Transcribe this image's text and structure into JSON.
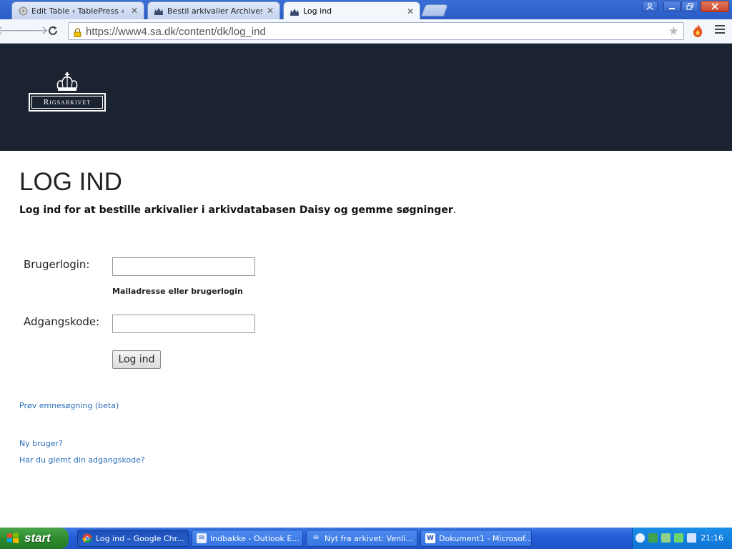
{
  "browser": {
    "tabs": [
      {
        "label": "Edit Table ‹ TablePress ‹ — W",
        "icon": "wordpress-icon",
        "active": false
      },
      {
        "label": "Bestil arkivalier Archives - Rig",
        "icon": "crown-icon",
        "active": false
      },
      {
        "label": "Log ind",
        "icon": "crown-icon",
        "active": true
      }
    ],
    "url": "https://www4.sa.dk/content/dk/log_ind"
  },
  "header": {
    "logo_text": "Rigsarkivet"
  },
  "page": {
    "title": "LOG IND",
    "lead": "Log ind for at bestille arkivalier i arkivdatabasen Daisy og gemme søgninger",
    "lead_dot": ".",
    "username_label": "Brugerlogin:",
    "username_value": "",
    "username_hint": "Mailadresse eller brugerlogin",
    "password_label": "Adgangskode:",
    "password_value": "",
    "submit_label": "Log ind",
    "links": {
      "topic_search": "Prøv emnesøgning (beta)",
      "new_user": "Ny bruger?",
      "forgot_password": "Har du glemt din adgangskode?"
    }
  },
  "taskbar": {
    "start_label": "start",
    "items": [
      {
        "label": "Log ind – Google Chr...",
        "icon": "chrome-icon",
        "active": true
      },
      {
        "label": "Indbakke - Outlook E...",
        "icon": "outlook-icon",
        "active": false
      },
      {
        "label": "Nyt fra arkivet: Venli...",
        "icon": "mail-icon",
        "active": false
      },
      {
        "label": "Dokument1 - Microsof...",
        "icon": "word-icon",
        "active": false
      }
    ],
    "clock": "21:16"
  },
  "colors": {
    "header_bg": "#1c2330",
    "link": "#2a6ebb",
    "taskbar": "#245ed9",
    "start_button": "#2d8b2d"
  }
}
